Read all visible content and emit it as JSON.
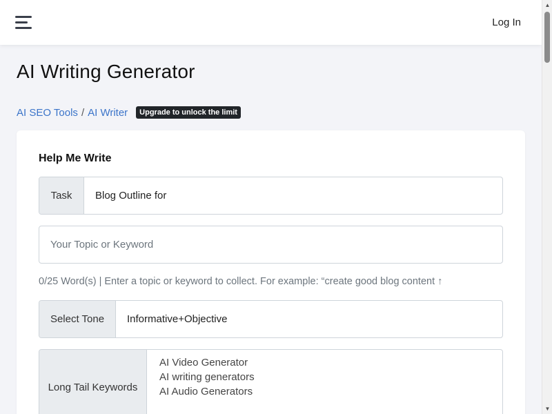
{
  "navbar": {
    "menu_icon": "hamburger-menu-icon",
    "login_label": "Log In"
  },
  "page": {
    "title": "AI Writing Generator"
  },
  "breadcrumb": {
    "items": [
      {
        "label": "AI SEO Tools"
      },
      {
        "label": "AI Writer"
      }
    ],
    "separator": "/",
    "badge": "Upgrade to unlock the limit"
  },
  "form": {
    "section_title": "Help Me Write",
    "task": {
      "label": "Task",
      "value": "Blog Outline for"
    },
    "topic": {
      "placeholder": "Your Topic or Keyword",
      "value": ""
    },
    "hint": "0/25 Word(s) | Enter a topic or keyword to collect. For example: “create good blog content ↑",
    "tone": {
      "label": "Select Tone",
      "value": "Informative+Objective"
    },
    "long_tail": {
      "label": "Long Tail Keywords",
      "items": [
        "AI Video Generator",
        "AI writing generators",
        "AI Audio Generators"
      ]
    }
  },
  "scrollbar": {
    "up_glyph": "▲",
    "down_glyph": "▼"
  },
  "colors": {
    "link": "#3b74c9",
    "badge_bg": "#212529",
    "addon_bg": "#e9ecef",
    "page_bg": "#f3f4f8"
  }
}
